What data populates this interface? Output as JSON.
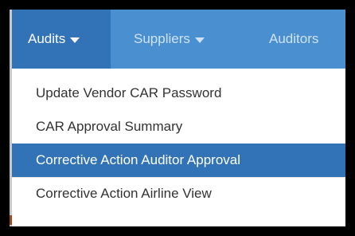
{
  "navbar": {
    "items": [
      {
        "label": "Audits",
        "active": true
      },
      {
        "label": "Suppliers",
        "active": false
      },
      {
        "label": "Auditors",
        "active": false
      }
    ]
  },
  "dropdown": {
    "items": [
      {
        "label": "Update Vendor CAR Password",
        "active": false
      },
      {
        "label": "CAR Approval Summary",
        "active": false
      },
      {
        "label": "Corrective Action Auditor Approval",
        "active": true
      },
      {
        "label": "Corrective Action Airline View",
        "active": false
      }
    ]
  },
  "colors": {
    "navbar_bg": "#4a90d0",
    "active_bg": "#3273b8",
    "frame": "#000000"
  }
}
